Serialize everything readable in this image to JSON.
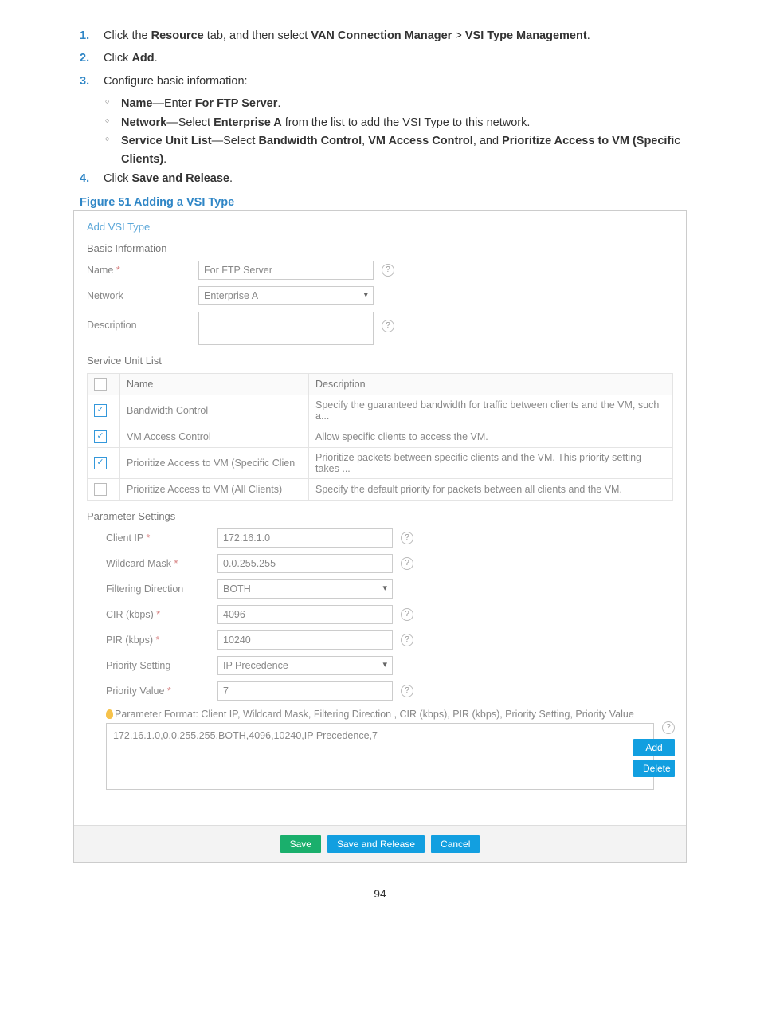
{
  "steps": [
    {
      "num": "1.",
      "parts": [
        "Click the ",
        "Resource",
        " tab, and then select ",
        "VAN Connection Manager",
        " > ",
        "VSI Type Management",
        "."
      ]
    },
    {
      "num": "2.",
      "parts": [
        "Click ",
        "Add",
        "."
      ]
    },
    {
      "num": "3.",
      "parts": [
        "Configure basic information:"
      ]
    },
    {
      "num": "4.",
      "parts": [
        "Click ",
        "Save and Release",
        "."
      ]
    }
  ],
  "subitems": [
    [
      "Name",
      "—Enter ",
      "For FTP Server",
      "."
    ],
    [
      "Network",
      "—Select ",
      "Enterprise A",
      " from the list to add the VSI Type to this network."
    ],
    [
      "Service Unit List",
      "—Select ",
      "Bandwidth Control",
      ", ",
      "VM Access Control",
      ", and ",
      "Prioritize Access to VM (Specific Clients)",
      "."
    ]
  ],
  "figcaption": "Figure 51 Adding a VSI Type",
  "ui": {
    "crumb": "Add VSI Type",
    "basic": "Basic Information",
    "name_label": "Name",
    "name_value": "For FTP Server",
    "network_label": "Network",
    "network_value": "Enterprise A",
    "desc_label": "Description",
    "sul": "Service Unit List",
    "th_name": "Name",
    "th_desc": "Description",
    "rows": [
      {
        "c": true,
        "n": "Bandwidth Control",
        "d": "Specify the guaranteed bandwidth for traffic between clients and the VM, such a..."
      },
      {
        "c": true,
        "n": "VM Access Control",
        "d": "Allow specific clients to access the VM."
      },
      {
        "c": true,
        "n": "Prioritize Access to VM (Specific Clien",
        "d": "Prioritize packets between specific clients and the VM. This priority setting takes ..."
      },
      {
        "c": false,
        "n": "Prioritize Access to VM (All Clients)",
        "d": "Specify the default priority for packets between all clients and the VM."
      }
    ],
    "paramset": "Parameter Settings",
    "params": [
      {
        "l": "Client IP",
        "req": true,
        "v": "172.16.1.0",
        "t": "input",
        "h": true
      },
      {
        "l": "Wildcard Mask",
        "req": true,
        "v": "0.0.255.255",
        "t": "input",
        "h": true
      },
      {
        "l": "Filtering Direction",
        "req": false,
        "v": "BOTH",
        "t": "select",
        "h": false
      },
      {
        "l": "CIR (kbps)",
        "req": true,
        "v": "4096",
        "t": "input",
        "h": true
      },
      {
        "l": "PIR (kbps)",
        "req": true,
        "v": "10240",
        "t": "input",
        "h": true
      },
      {
        "l": "Priority Setting",
        "req": false,
        "v": "IP Precedence",
        "t": "select",
        "h": false
      },
      {
        "l": "Priority Value",
        "req": true,
        "v": "7",
        "t": "input",
        "h": true
      }
    ],
    "note": "Parameter Format: Client IP,  Wildcard Mask,  Filtering Direction ,  CIR (kbps),  PIR (kbps),  Priority Setting,  Priority Value",
    "paste": "172.16.1.0,0.0.255.255,BOTH,4096,10240,IP Precedence,7",
    "add": "Add",
    "delete": "Delete",
    "save": "Save",
    "save_release": "Save and Release",
    "cancel": "Cancel"
  },
  "pagenum": "94"
}
